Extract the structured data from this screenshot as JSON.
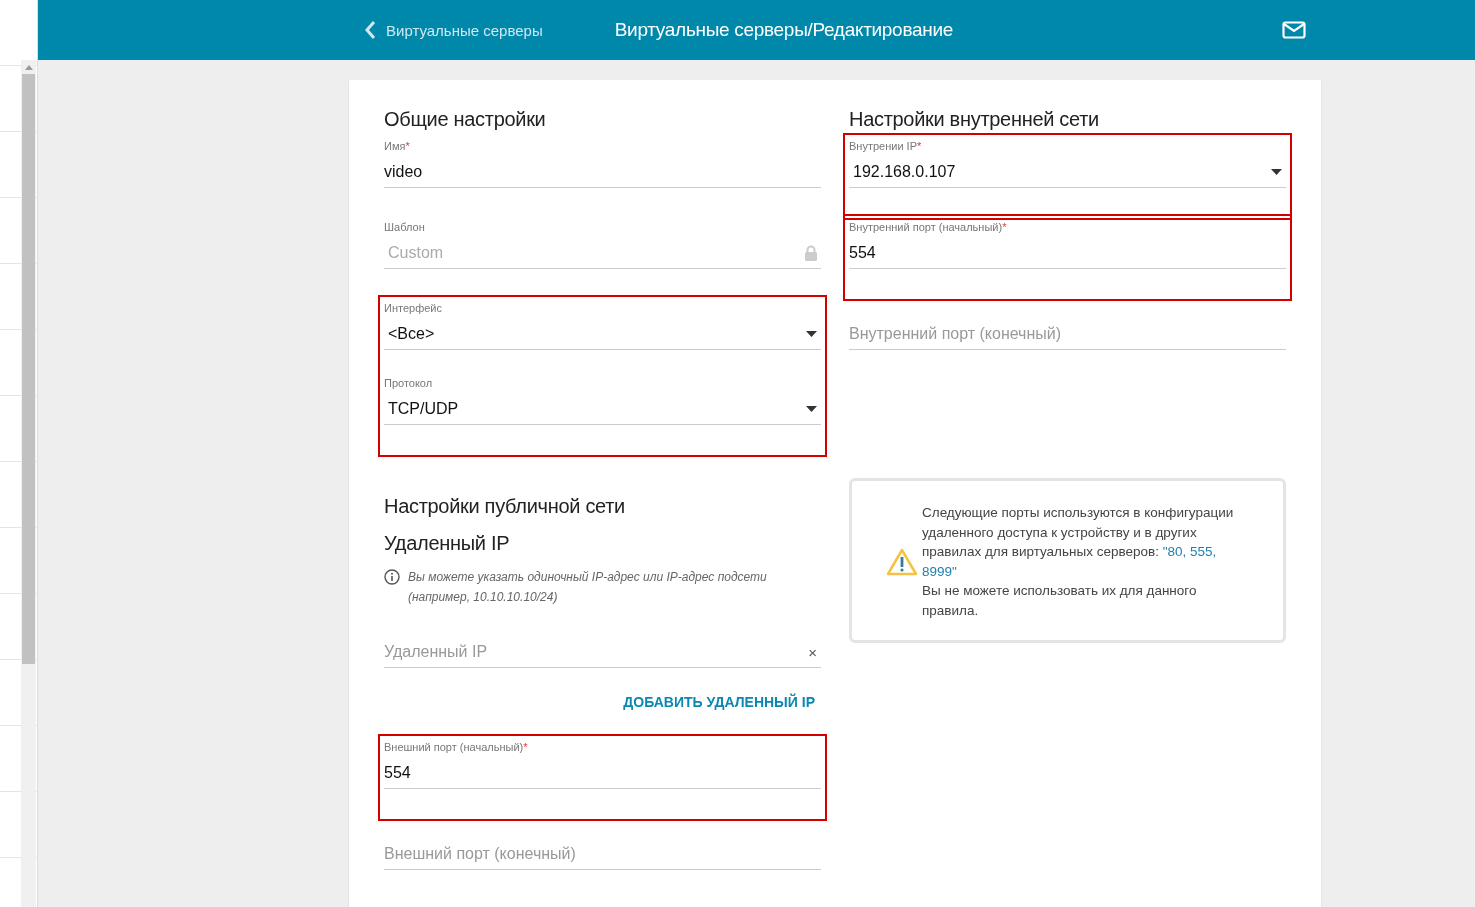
{
  "header": {
    "back_label": "Виртуальные серверы",
    "title": "Виртуальные серверы/Редактирование"
  },
  "general": {
    "heading": "Общие настройки",
    "blocks": [
      {
        "highlighted": false,
        "fields": [
          {
            "kind": "text",
            "label": "Имя",
            "mark": "*",
            "value": "video"
          }
        ]
      },
      {
        "highlighted": false,
        "fields": [
          {
            "kind": "locked",
            "label": "Шаблон",
            "value": "Custom"
          }
        ]
      },
      {
        "highlighted": true,
        "fields": [
          {
            "kind": "select",
            "label": "Интерфейс",
            "value": "<Все>"
          },
          {
            "kind": "select",
            "label": "Протокол",
            "value": "TCP/UDP"
          }
        ]
      }
    ]
  },
  "public": {
    "heading": "Настройки публичной сети",
    "subheading": "Удаленный IP",
    "hint": "Вы можете указать одиночный IP-адрес или IP-адрес подсети (например, 10.10.10.10/24)",
    "remote_field": {
      "kind": "clearable",
      "placeholder": "Удаленный IP",
      "clear": "×"
    },
    "add_link": "ДОБАВИТЬ УДАЛЕННЫЙ IP",
    "blocks": [
      {
        "highlighted": true,
        "fields": [
          {
            "kind": "text",
            "label": "Внешний порт (начальный)",
            "mark": "*",
            "value": "554"
          }
        ]
      },
      {
        "highlighted": false,
        "fields": [
          {
            "kind": "text",
            "placeholder": "Внешний порт (конечный)"
          }
        ]
      }
    ]
  },
  "internal": {
    "heading": "Настройки внутренней сети",
    "blocks": [
      {
        "highlighted": true,
        "fields": [
          {
            "kind": "select",
            "label": "Внутрении IP",
            "mark": "*",
            "value": "192.168.0.107"
          }
        ]
      },
      {
        "highlighted": true,
        "fields": [
          {
            "kind": "text",
            "label": "Внутренний порт (начальный)",
            "mark": "*",
            "value": "554"
          }
        ]
      },
      {
        "highlighted": false,
        "fields": [
          {
            "kind": "text",
            "placeholder": "Внутренний порт (конечный)"
          }
        ]
      }
    ]
  },
  "warning": {
    "text_before": "Следующие порты используются в конфигурации удаленного доступа к устройству и в других правилах для виртуальных серверов: ",
    "ports": "\"80, 555, 8999\"",
    "text_after": "Вы не можете использовать их для данного правила."
  }
}
